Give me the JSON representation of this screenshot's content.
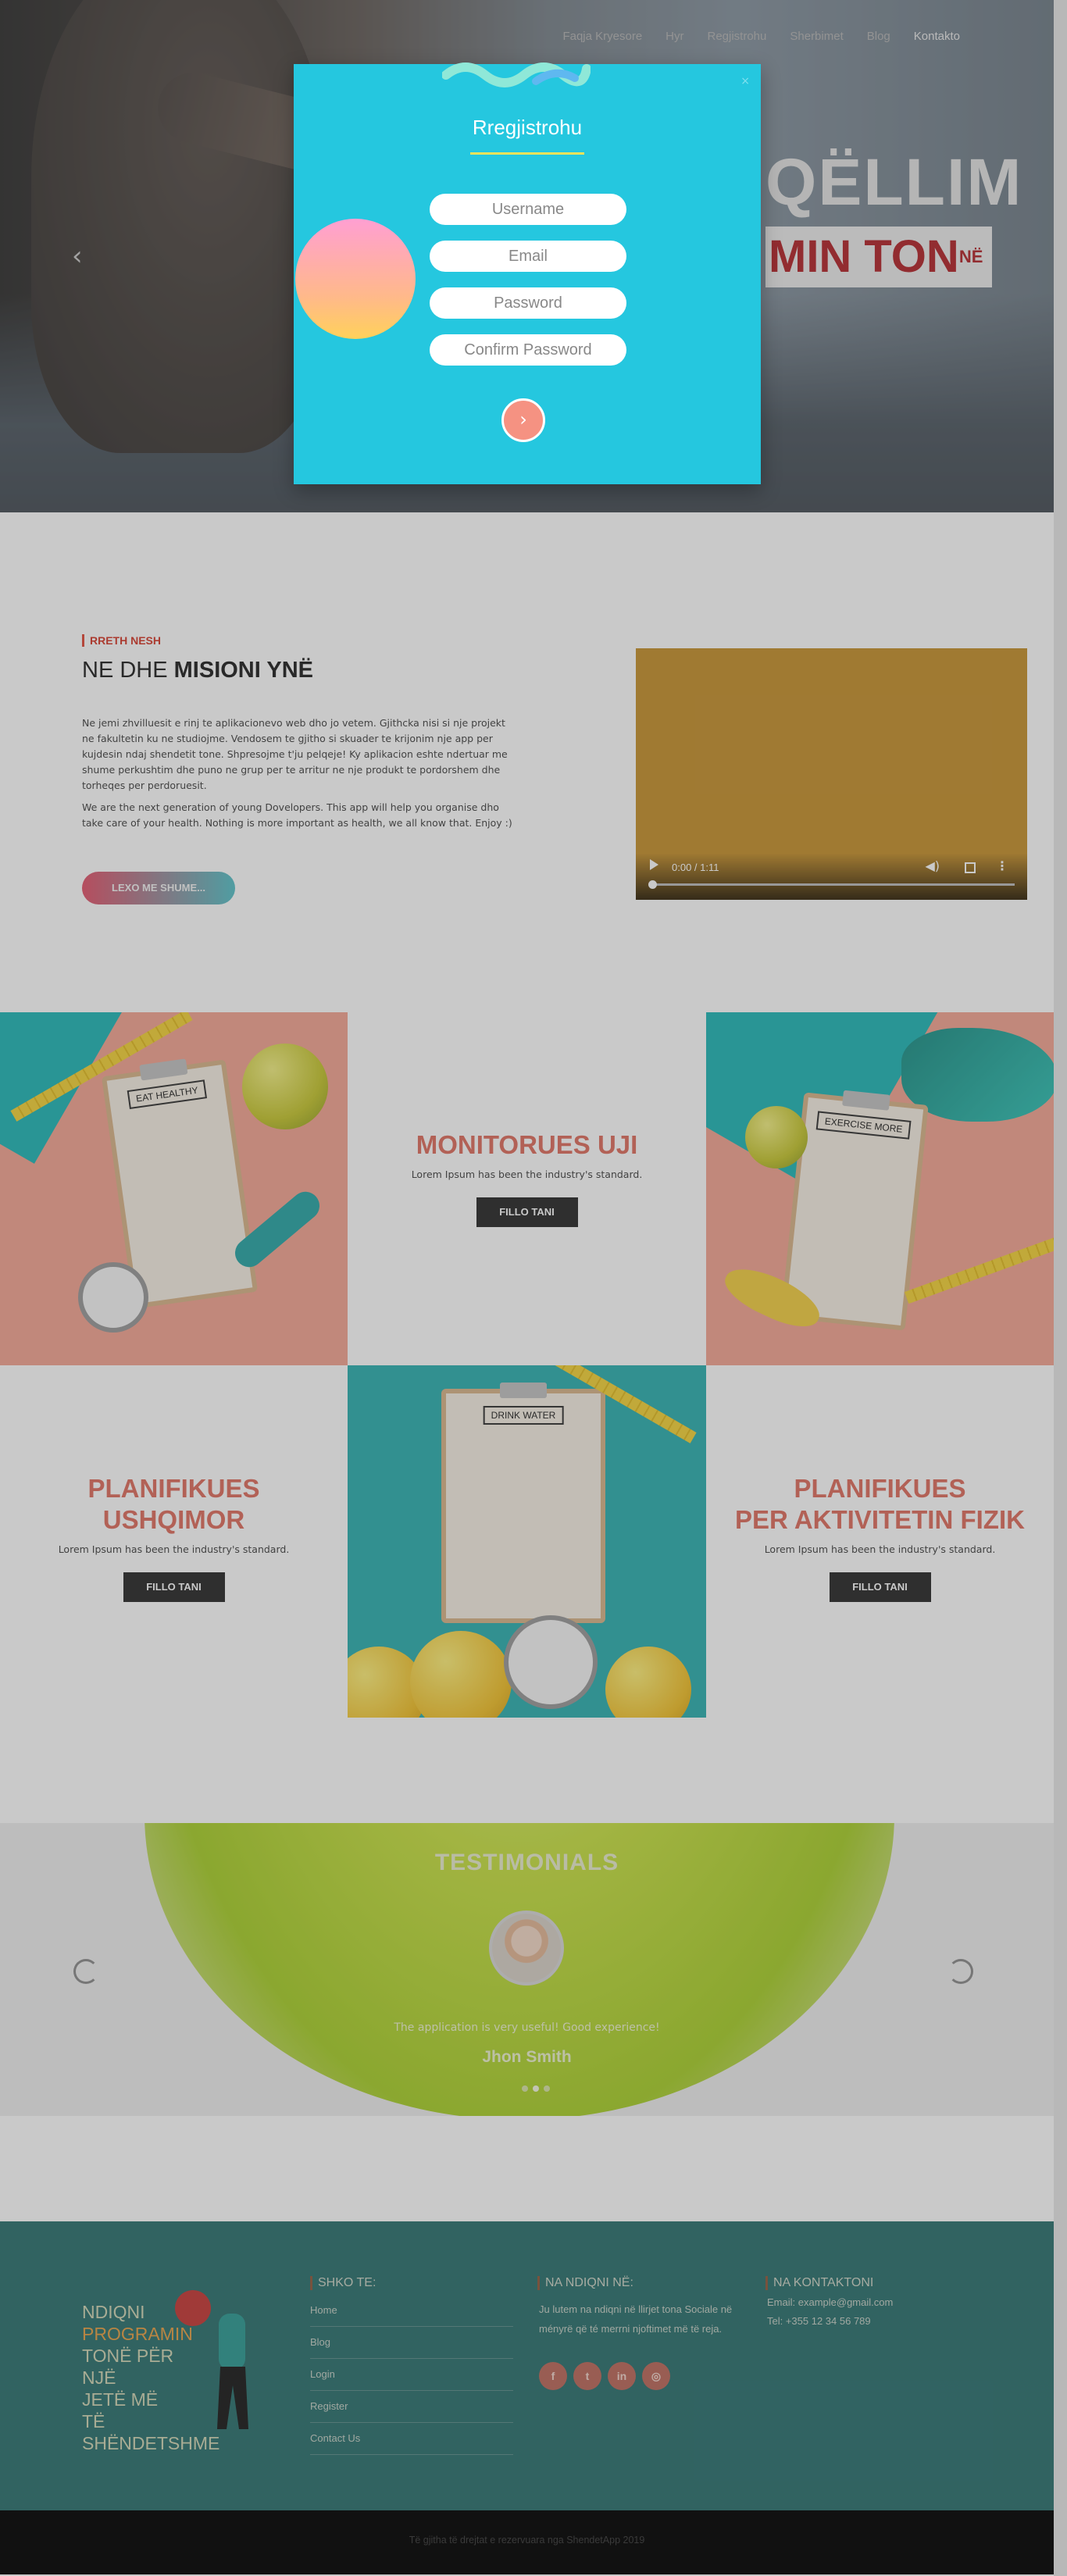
{
  "nav": {
    "items": [
      "Faqja Kryesore",
      "Hyr",
      "Regjistrohu",
      "Sherbimet",
      "Blog",
      "Kontakto"
    ],
    "active_index": 5
  },
  "hero": {
    "title_line1": "QËLLIM",
    "title_line2": "MIN TON",
    "title_suffix": "NË",
    "prev_icon": "chevron-left-icon"
  },
  "modal": {
    "title": "Rregjistrohu",
    "close_label": "×",
    "fields": {
      "username": "Username",
      "email": "Email",
      "password": "Password",
      "confirm": "Confirm Password"
    },
    "submit_icon": "arrow-right-icon",
    "colors": {
      "background": "#25c7df",
      "accent": "#f2e35a",
      "button": "#f59282"
    }
  },
  "about": {
    "kicker": "RRETH NESH",
    "heading_regular": "NE DHE ",
    "heading_bold": "MISIONI YNË",
    "p1": "Ne jemi zhvilluesit e rinj te aplikacionevo web dho jo vetem. Gjithcka nisi si nje projekt ne fakultetin ku ne studiojme. Vendosem te gjitho si skuader te krijonim nje app per kujdesin ndaj shendetit tone. Shpresojme t'ju pelqeje! Ky aplikacion eshte ndertuar me shume perkushtim dhe puno ne grup per te arritur ne nje produkt te pordorshem dhe torheqes per perdoruesit.",
    "p2": "We are the next generation of young Dovelopers. This app will help you organise dho take care of your health. Nothing is more important as health, we all know that. Enjoy :)",
    "button": "LEXO ME SHUME...",
    "video": {
      "time": "0:00 / 1:11",
      "progress": 0
    }
  },
  "features": {
    "water": {
      "title": "MONITORUES UJI",
      "subtitle": "Lorem Ipsum has been the industry's standard.",
      "button": "FILLO TANI"
    },
    "food": {
      "title_line1": "PLANIFIKUES",
      "title_line2": "USHQIMOR",
      "subtitle": "Lorem Ipsum has been the industry's standard.",
      "button": "FILLO TANI"
    },
    "fitness": {
      "title_line1": "PLANIFIKUES",
      "title_line2": "PER AKTIVITETIN FIZIK",
      "subtitle": "Lorem Ipsum has been the industry's standard.",
      "button": "FILLO TANI"
    },
    "photo_tags": {
      "eat": "EAT HEALTHY",
      "exercise": "EXERCISE MORE",
      "drink": "DRINK WATER"
    }
  },
  "testimonials": {
    "title": "TESTIMONIALS",
    "quote": "The application is very useful! Good experience!",
    "name": "Jhon Smith",
    "dots": 3,
    "active_dot": 1
  },
  "footer": {
    "brand_line1": "NDIQNI",
    "brand_line2": "PROGRAMIN",
    "brand_line3": "TONË PËR NJË",
    "brand_line4": "JETË MË TË",
    "brand_line5": "SHËNDETSHME",
    "links_title": "SHKO TE:",
    "links": [
      "Home",
      "Blog",
      "Login",
      "Register",
      "Contact Us"
    ],
    "follow_title": "NA NDIQNI NË:",
    "follow_text": "Ju lutem na ndiqni në llirjet tona Sociale në ményrë që té merrni njoftimet më të reja.",
    "social": [
      {
        "icon": "facebook-icon",
        "glyph": "f"
      },
      {
        "icon": "twitter-icon",
        "glyph": "t"
      },
      {
        "icon": "linkedin-icon",
        "glyph": "in"
      },
      {
        "icon": "instagram-icon",
        "glyph": "◎"
      }
    ],
    "contact_title": "NA KONTAKTONI",
    "email": "Email: example@gmail.com",
    "phone": "Tel: +355 12 34 56 789"
  },
  "copyright": "Të gjitha të drejtat e rezervuara nga ShendetApp 2019"
}
